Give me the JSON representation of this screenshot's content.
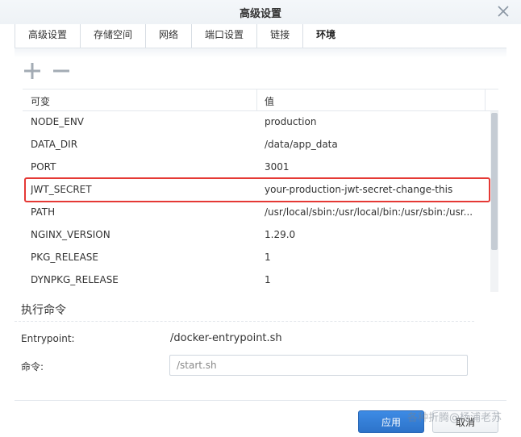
{
  "dialog": {
    "title": "高级设置"
  },
  "tabs": [
    {
      "label": "高级设置"
    },
    {
      "label": "存储空间"
    },
    {
      "label": "网络"
    },
    {
      "label": "端口设置"
    },
    {
      "label": "链接"
    },
    {
      "label": "环境",
      "active": true
    }
  ],
  "toolbar": {
    "add_icon": "plus-icon",
    "remove_icon": "minus-icon"
  },
  "table": {
    "headers": {
      "variable": "可变",
      "value": "值"
    },
    "rows": [
      {
        "variable": "NODE_ENV",
        "value": "production"
      },
      {
        "variable": "DATA_DIR",
        "value": "/data/app_data"
      },
      {
        "variable": "PORT",
        "value": "3001"
      },
      {
        "variable": "JWT_SECRET",
        "value": "your-production-jwt-secret-change-this"
      },
      {
        "variable": "PATH",
        "value": "/usr/local/sbin:/usr/local/bin:/usr/sbin:/usr..."
      },
      {
        "variable": "NGINX_VERSION",
        "value": "1.29.0"
      },
      {
        "variable": "PKG_RELEASE",
        "value": "1"
      },
      {
        "variable": "DYNPKG_RELEASE",
        "value": "1"
      }
    ]
  },
  "execute": {
    "section_title": "执行命令",
    "entrypoint_label": "Entrypoint:",
    "entrypoint_value": "/docker-entrypoint.sh",
    "command_label": "命令:",
    "command_value": "/start.sh"
  },
  "buttons": {
    "apply": "应用",
    "cancel": "取消"
  },
  "watermark": "各种折腾@杨浦老苏",
  "colors": {
    "accent": "#2d73c9",
    "highlight": "#e53935"
  }
}
